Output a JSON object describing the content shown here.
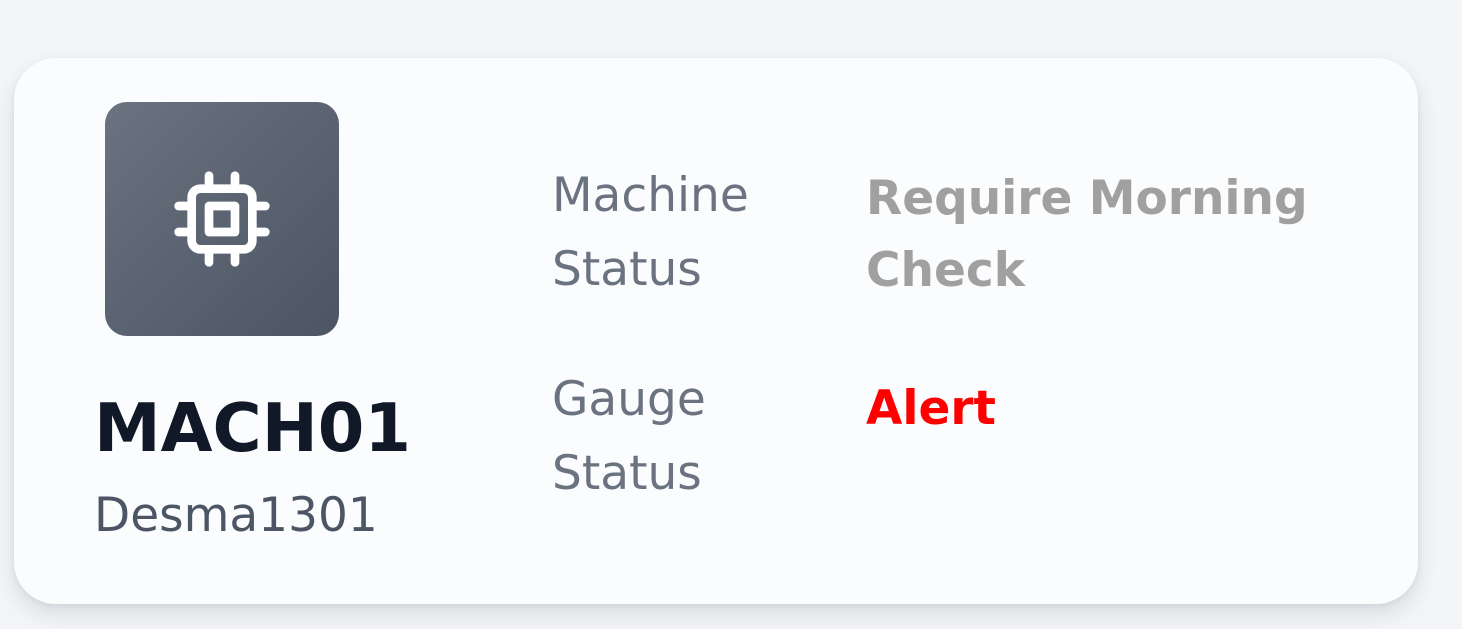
{
  "card": {
    "icon": "cpu-chip-icon",
    "machine_id": "MACH01",
    "machine_model": "Desma1301",
    "machine_status": {
      "label": "Machine Status",
      "value": "Require Morning Check",
      "color": "#a0a0a0"
    },
    "gauge_status": {
      "label": "Gauge Status",
      "value": "Alert",
      "color": "#ff0000"
    }
  }
}
